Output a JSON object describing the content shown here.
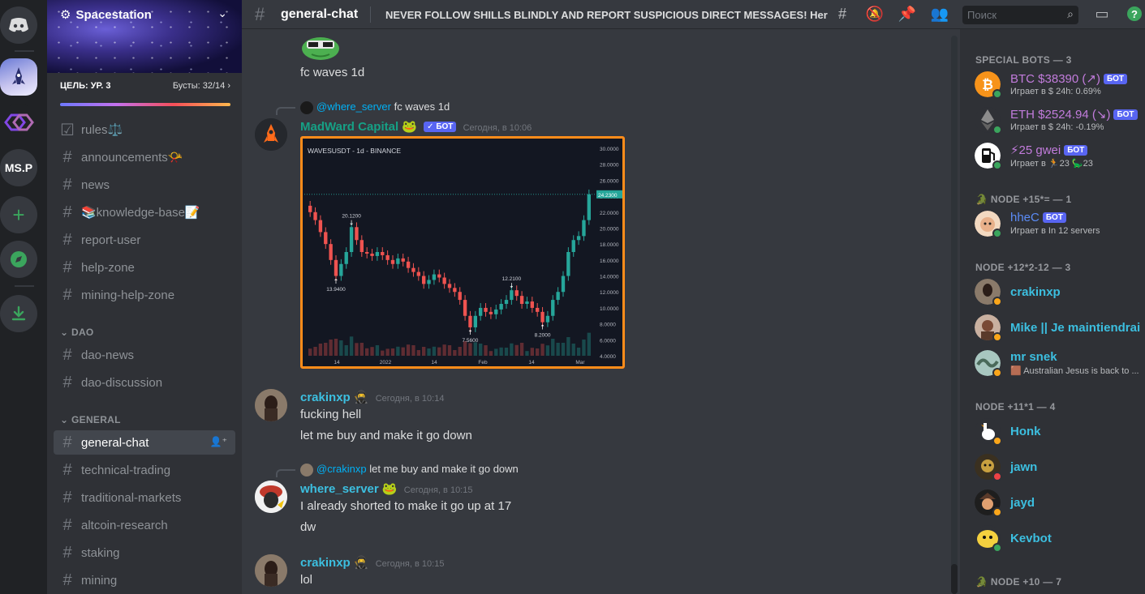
{
  "server": {
    "name": "Spacestation",
    "boost_goal": "ЦЕЛЬ: УР. 3",
    "boost_count": "Бусты: 32/14",
    "rail_label": "MS.P"
  },
  "channels_top": [
    {
      "name": "rules⚖️"
    },
    {
      "name": "announcements📯"
    },
    {
      "name": "news"
    },
    {
      "name": "📚knowledge-base📝"
    },
    {
      "name": "report-user"
    },
    {
      "name": "help-zone"
    },
    {
      "name": "mining-help-zone"
    }
  ],
  "categories": {
    "dao": "DAO",
    "general": "GENERAL"
  },
  "channels_dao": [
    {
      "name": "dao-news"
    },
    {
      "name": "dao-discussion"
    }
  ],
  "channels_general": [
    {
      "name": "general-chat"
    },
    {
      "name": "technical-trading"
    },
    {
      "name": "traditional-markets"
    },
    {
      "name": "altcoin-research"
    },
    {
      "name": "staking"
    },
    {
      "name": "mining"
    }
  ],
  "header": {
    "channel": "general-chat",
    "topic": "NEVER FOLLOW SHILLS BLINDLY AND REPORT SUSPICIOUS DIRECT MESSAGES! Here y...",
    "search_placeholder": "Поиск"
  },
  "messages": {
    "m0_text": "fc waves 1d",
    "m1_reply_mention": "@where_server",
    "m1_reply_text": "fc waves 1d",
    "m1_author": "MadWard Capital",
    "m1_bot": "✓ БОТ",
    "m1_time": "Сегодня, в 10:06",
    "m2_author": "crakinxp",
    "m2_time": "Сегодня, в 10:14",
    "m2_line1": "fucking hell",
    "m2_line2": "let me buy and make it go down",
    "m3_reply_mention": "@crakinxp",
    "m3_reply_text": "let me buy and make it go down",
    "m3_author": "where_server",
    "m3_time": "Сегодня, в 10:15",
    "m3_line1": "I already shorted to make it go up at 17",
    "m3_line2": "dw",
    "m4_author": "crakinxp",
    "m4_time": "Сегодня, в 10:15",
    "m4_line1": "lol"
  },
  "chart_data": {
    "type": "line",
    "title": "WAVESUSDT · 1d · BINANCE",
    "x_ticks": [
      "14",
      "2022",
      "14",
      "Feb",
      "14",
      "Mar"
    ],
    "y_ticks": [
      "30.0000",
      "28.0000",
      "26.0000",
      "24.0000",
      "22.0000",
      "20.0000",
      "18.0000",
      "16.0000",
      "14.0000",
      "12.0000",
      "10.0000",
      "8.0000",
      "6.0000",
      "4.0000"
    ],
    "ylim": [
      4,
      30
    ],
    "current_price": "24.2300",
    "annotations": [
      "20.1200",
      "13.9400",
      "7.5600",
      "12.2100",
      "8.2000"
    ],
    "series": [
      {
        "values": [
          22,
          21,
          19.5,
          18,
          16,
          14,
          15.5,
          17,
          20.12,
          18.5,
          17,
          16.8,
          16.5,
          17,
          16.6,
          16,
          15.5,
          16.2,
          15.8,
          15,
          14.5,
          14,
          13,
          13.5,
          14.2,
          13.8,
          13,
          12.5,
          12,
          11,
          9,
          7.56,
          9,
          10,
          9.5,
          9.2,
          9.8,
          10.5,
          11,
          12.21,
          11.5,
          10.5,
          10.8,
          10,
          9.5,
          8.2,
          9,
          11,
          12,
          14,
          17,
          18.5,
          19,
          21,
          24.23
        ]
      }
    ],
    "colors": {
      "up": "#26a69a",
      "down": "#ef5350"
    }
  },
  "members": {
    "g1": "SPECIAL BOTS — 3",
    "b1_name": "BTC $38390 (↗)",
    "b1_sub": "Играет в $ 24h: 0.69%",
    "b2_name": "ETH $2524.94 (↘)",
    "b2_sub": "Играет в $ 24h: -0.19%",
    "b3_name": "⚡25 gwei",
    "b3_sub": "Играет в 🏃23 🦕23",
    "bot_tag": "БОТ",
    "g2": "NODE +15*= — 1",
    "n1_name": "hheC",
    "n1_sub": "Играет в In 12 servers",
    "g3": "NODE +12*2-12 — 3",
    "n2_name": "crakinxp",
    "n3_name": "Mike || Je maintiendrai",
    "n4_name": "mr snek",
    "n4_sub": "Australian Jesus is back to ...",
    "g4": "NODE +11*1 — 4",
    "n5_name": "Honk",
    "n6_name": "jawn",
    "n7_name": "jayd",
    "n8_name": "Kevbot",
    "g5": "NODE +10 — 7"
  }
}
